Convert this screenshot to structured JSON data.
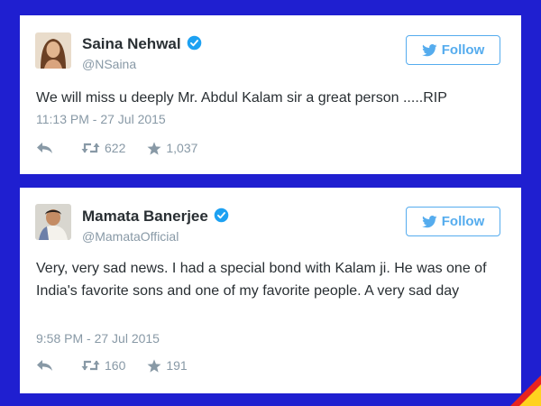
{
  "colors": {
    "background": "#1f1fd0",
    "card": "#ffffff",
    "name_text": "#292f33",
    "muted_text": "#8899a6",
    "follow_blue": "#55acee",
    "verified_blue": "#1da1f2"
  },
  "icons": [
    "verified-badge-icon",
    "twitter-bird-icon",
    "reply-icon",
    "retweet-icon",
    "star-icon"
  ],
  "tweets": [
    {
      "name": "Saina Nehwal",
      "handle": "@NSaina",
      "follow_label": "Follow",
      "text": "We will miss u deeply Mr. Abdul Kalam sir a great person .....RIP",
      "timestamp": "11:13 PM - 27 Jul 2015",
      "retweets": "622",
      "favorites": "1,037"
    },
    {
      "name": "Mamata Banerjee",
      "handle": "@MamataOfficial",
      "follow_label": "Follow",
      "text": "Very, very sad news. I had a special bond with Kalam ji. He was one of India's favorite sons and one of my favorite people. A very sad day",
      "timestamp": "9:58 PM - 27 Jul 2015",
      "retweets": "160",
      "favorites": "191"
    }
  ]
}
